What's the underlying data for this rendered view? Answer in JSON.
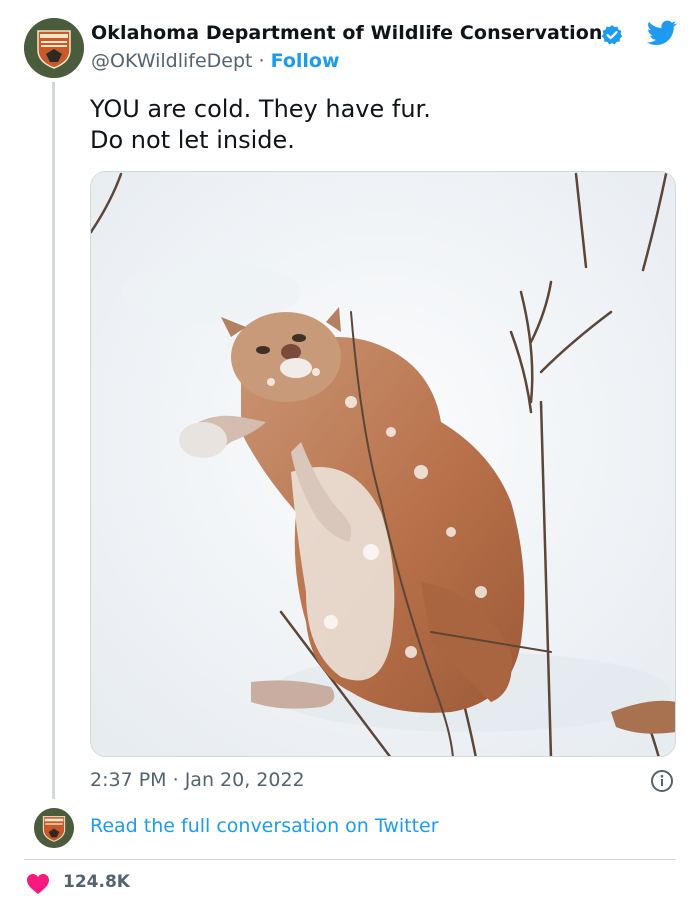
{
  "author": {
    "name": "Oklahoma Department of Wildlife Conservation",
    "handle": "@OKWildlifeDept",
    "separator": "·",
    "follow_label": "Follow",
    "verified": true
  },
  "tweet": {
    "line1": "YOU are cold. They have fur.",
    "line2": "Do not let inside."
  },
  "meta": {
    "time": "2:37 PM",
    "separator": "·",
    "date": "Jan 20, 2022"
  },
  "conversation_link": "Read the full conversation on Twitter",
  "likes": "124.8K",
  "colors": {
    "accent": "#1d9bf0",
    "heart": "#f91880",
    "secondary_text": "#536471",
    "border": "#cfd9de"
  },
  "icons": [
    "verified-badge-icon",
    "twitter-bird-icon",
    "info-icon",
    "heart-icon"
  ]
}
